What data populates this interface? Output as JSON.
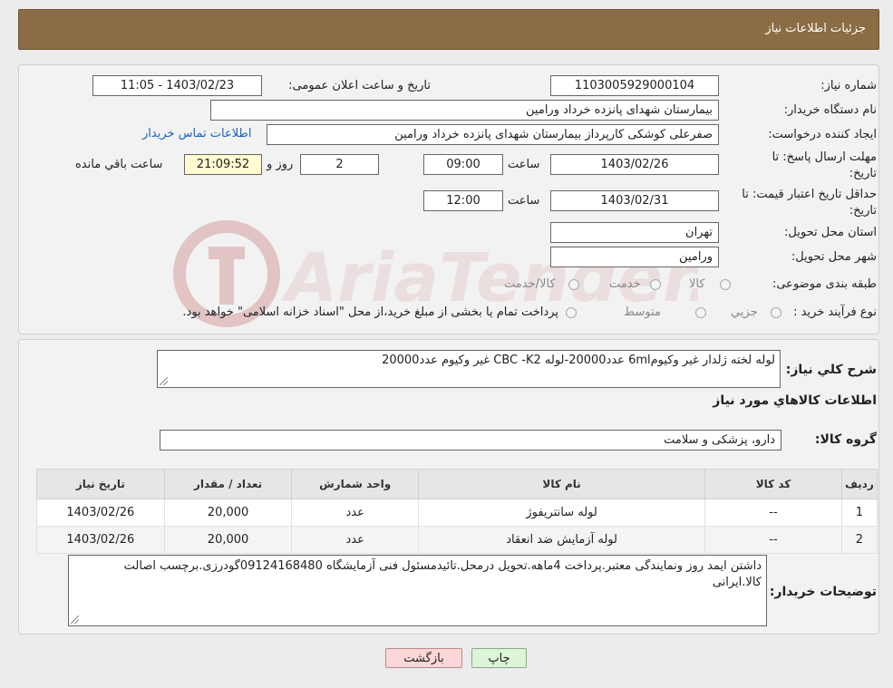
{
  "header": {
    "title": "جزئیات اطلاعات نیاز"
  },
  "form": {
    "need_number_label": "شماره نیاز:",
    "need_number": "1103005929000104",
    "announce_label": "تاریخ و ساعت اعلان عمومی:",
    "announce_value": "1403/02/23 - 11:05",
    "buyer_label": "نام دستگاه خریدار:",
    "buyer_value": "بیمارستان شهدای پانزده خرداد ورامین",
    "requester_label": "ایجاد کننده درخواست:",
    "requester_value": "صفرعلی کوشکی کارپرداز بیمارستان شهدای پانزده خرداد ورامین",
    "contact_link": "اطلاعات تماس خریدار",
    "deadline_label_1": "مهلت ارسال پاسخ: تا",
    "deadline_label_2": "تاریخ:",
    "deadline_date": "1403/02/26",
    "hour_label": "ساعت",
    "deadline_time": "09:00",
    "days_value": "2",
    "days_label": "روز و",
    "remaining_time": "21:09:52",
    "remaining_label": "ساعت باقي مانده",
    "validity_label_1": "حداقل تاریخ اعتبار قیمت: تا",
    "validity_label_2": "تاریخ:",
    "validity_date": "1403/02/31",
    "validity_time": "12:00",
    "province_label": "استان محل تحویل:",
    "province_value": "تهران",
    "city_label": "شهر محل تحویل:",
    "city_value": "ورامین",
    "category_label": "طبقه بندی موضوعی:",
    "category_options": [
      "کالا",
      "خدمت",
      "کالا/خدمت"
    ],
    "process_label": "نوع فرآیند خرید :",
    "process_options": [
      "جزیي",
      "متوسط"
    ],
    "process_note": "پرداخت تمام یا بخشی از مبلغ خرید،از محل \"اسناد خزانه اسلامی\" خواهد بود."
  },
  "details": {
    "description_label": "شرح کلي نياز:",
    "description_value": "لوله لخته ژلدار غیر وکیوم6ml عدد20000-لوله CBC -K2 غیر وکیوم عدد20000",
    "goods_info_title": "اطلاعات کالاهاي مورد نياز",
    "goods_group_label": "گروه کالا:",
    "goods_group_value": "دارو، پزشکی و سلامت",
    "table": {
      "headers": [
        "رديف",
        "کد کالا",
        "نام کالا",
        "واحد شمارش",
        "تعداد / مقدار",
        "تاریخ نیاز"
      ],
      "rows": [
        [
          "1",
          "--",
          "لوله سانتریفوژ",
          "عدد",
          "20,000",
          "1403/02/26"
        ],
        [
          "2",
          "--",
          "لوله آزمایش ضد انعقاد",
          "عدد",
          "20,000",
          "1403/02/26"
        ]
      ]
    },
    "buyer_notes_label": "توضیحات خریدار:",
    "buyer_notes_value": "داشتن ایمد روز ونمایندگی معتبر.پرداخت 4ماهه.تحویل درمحل.تائیدمسئول فنی آزمایشگاه 09124168480گودرزی.برچسب اصالت کالا.ایرانی"
  },
  "buttons": {
    "print": "چاپ",
    "back": "بازگشت"
  },
  "colors": {
    "header_bg": "#8a6d44",
    "link": "#1565c0",
    "back_btn": "#fbd7d7",
    "print_btn": "#dcf5d6"
  }
}
